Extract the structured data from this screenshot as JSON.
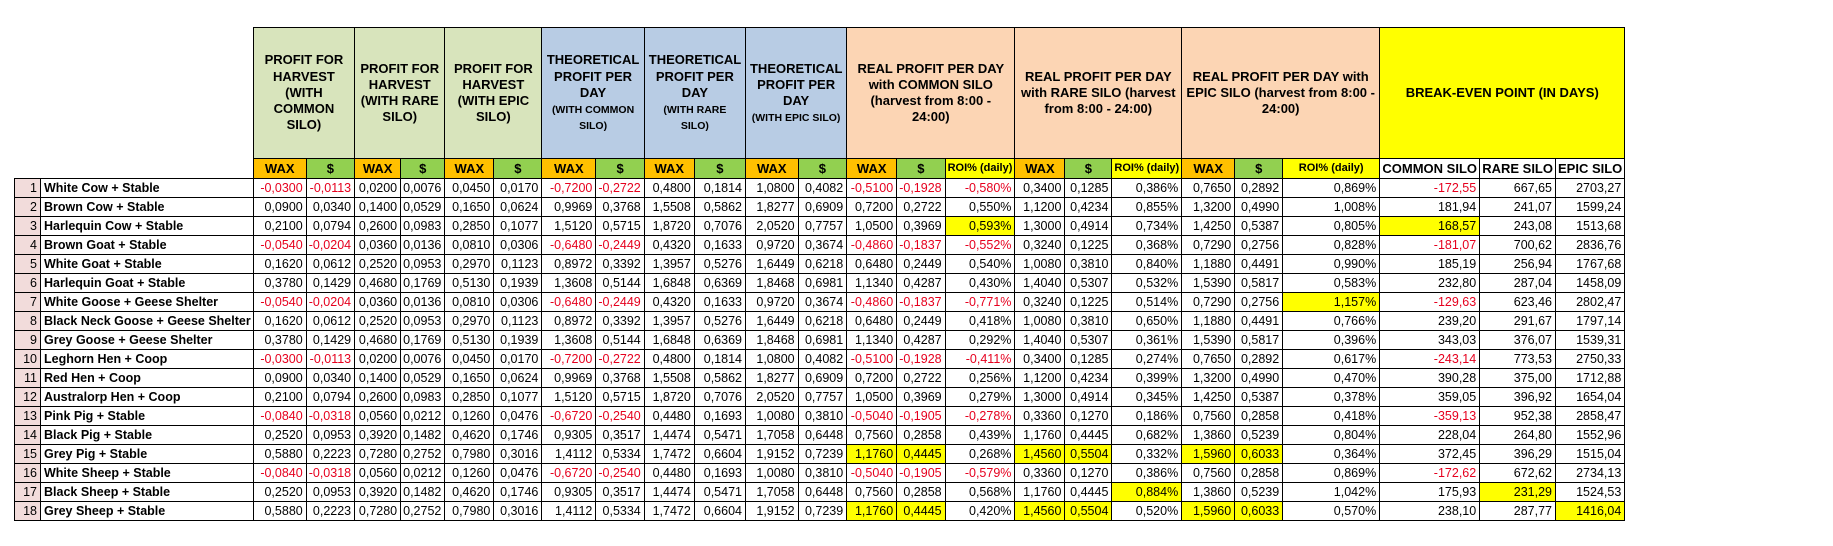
{
  "group_headers": [
    {
      "title": "PROFIT FOR HARVEST (WITH COMMON SILO)",
      "sub": ""
    },
    {
      "title": "PROFIT FOR HARVEST (WITH RARE SILO)",
      "sub": ""
    },
    {
      "title": "PROFIT FOR HARVEST (WITH EPIC SILO)",
      "sub": ""
    },
    {
      "title": "THEORETICAL PROFIT PER DAY",
      "sub": "(WITH COMMON SILO)"
    },
    {
      "title": "THEORETICAL PROFIT PER DAY",
      "sub": "(WITH RARE SILO)"
    },
    {
      "title": "THEORETICAL PROFIT PER DAY",
      "sub": "(WITH EPIC SILO)"
    },
    {
      "title": "REAL PROFIT PER DAY with COMMON SILO (harvest from 8:00 - 24:00)",
      "sub": ""
    },
    {
      "title": "REAL PROFIT PER DAY with RARE SILO (harvest from 8:00 - 24:00)",
      "sub": ""
    },
    {
      "title": "REAL PROFIT PER DAY with EPIC SILO (harvest from 8:00 - 24:00)",
      "sub": ""
    },
    {
      "title": "BREAK-EVEN POINT (IN DAYS)",
      "sub": ""
    }
  ],
  "sub_headers": {
    "wax": "WAX",
    "usd": "$",
    "roi": "ROI% (daily)",
    "common": "COMMON SILO",
    "rare": "RARE SILO",
    "epic": "EPIC SILO"
  },
  "rows": [
    {
      "n": "1",
      "name": "White Cow + Stable",
      "v": [
        "-0,0300",
        "-0,0113",
        "0,0200",
        "0,0076",
        "0,0450",
        "0,0170",
        "-0,7200",
        "-0,2722",
        "0,4800",
        "0,1814",
        "1,0800",
        "0,4082",
        "-0,5100",
        "-0,1928",
        "-0,580%",
        "0,3400",
        "0,1285",
        "0,386%",
        "0,7650",
        "0,2892",
        "0,869%",
        "-172,55",
        "667,65",
        "2703,27"
      ]
    },
    {
      "n": "2",
      "name": "Brown Cow  + Stable",
      "v": [
        "0,0900",
        "0,0340",
        "0,1400",
        "0,0529",
        "0,1650",
        "0,0624",
        "0,9969",
        "0,3768",
        "1,5508",
        "0,5862",
        "1,8277",
        "0,6909",
        "0,7200",
        "0,2722",
        "0,550%",
        "1,1200",
        "0,4234",
        "0,855%",
        "1,3200",
        "0,4990",
        "1,008%",
        "181,94",
        "241,07",
        "1599,24"
      ]
    },
    {
      "n": "3",
      "name": "Harlequin Cow + Stable",
      "v": [
        "0,2100",
        "0,0794",
        "0,2600",
        "0,0983",
        "0,2850",
        "0,1077",
        "1,5120",
        "0,5715",
        "1,8720",
        "0,7076",
        "2,0520",
        "0,7757",
        "1,0500",
        "0,3969",
        "0,593%",
        "1,3000",
        "0,4914",
        "0,734%",
        "1,4250",
        "0,5387",
        "0,805%",
        "168,57",
        "243,08",
        "1513,68"
      ]
    },
    {
      "n": "4",
      "name": "Brown Goat + Stable",
      "v": [
        "-0,0540",
        "-0,0204",
        "0,0360",
        "0,0136",
        "0,0810",
        "0,0306",
        "-0,6480",
        "-0,2449",
        "0,4320",
        "0,1633",
        "0,9720",
        "0,3674",
        "-0,4860",
        "-0,1837",
        "-0,552%",
        "0,3240",
        "0,1225",
        "0,368%",
        "0,7290",
        "0,2756",
        "0,828%",
        "-181,07",
        "700,62",
        "2836,76"
      ]
    },
    {
      "n": "5",
      "name": "White Goat + Stable",
      "v": [
        "0,1620",
        "0,0612",
        "0,2520",
        "0,0953",
        "0,2970",
        "0,1123",
        "0,8972",
        "0,3392",
        "1,3957",
        "0,5276",
        "1,6449",
        "0,6218",
        "0,6480",
        "0,2449",
        "0,540%",
        "1,0080",
        "0,3810",
        "0,840%",
        "1,1880",
        "0,4491",
        "0,990%",
        "185,19",
        "256,94",
        "1767,68"
      ]
    },
    {
      "n": "6",
      "name": "Harlequin Goat + Stable",
      "v": [
        "0,3780",
        "0,1429",
        "0,4680",
        "0,1769",
        "0,5130",
        "0,1939",
        "1,3608",
        "0,5144",
        "1,6848",
        "0,6369",
        "1,8468",
        "0,6981",
        "1,1340",
        "0,4287",
        "0,430%",
        "1,4040",
        "0,5307",
        "0,532%",
        "1,5390",
        "0,5817",
        "0,583%",
        "232,80",
        "287,04",
        "1458,09"
      ]
    },
    {
      "n": "7",
      "name": "White Goose + Geese Shelter",
      "v": [
        "-0,0540",
        "-0,0204",
        "0,0360",
        "0,0136",
        "0,0810",
        "0,0306",
        "-0,6480",
        "-0,2449",
        "0,4320",
        "0,1633",
        "0,9720",
        "0,3674",
        "-0,4860",
        "-0,1837",
        "-0,771%",
        "0,3240",
        "0,1225",
        "0,514%",
        "0,7290",
        "0,2756",
        "1,157%",
        "-129,63",
        "623,46",
        "2802,47"
      ]
    },
    {
      "n": "8",
      "name": "Black Neck Goose + Geese Shelter",
      "v": [
        "0,1620",
        "0,0612",
        "0,2520",
        "0,0953",
        "0,2970",
        "0,1123",
        "0,8972",
        "0,3392",
        "1,3957",
        "0,5276",
        "1,6449",
        "0,6218",
        "0,6480",
        "0,2449",
        "0,418%",
        "1,0080",
        "0,3810",
        "0,650%",
        "1,1880",
        "0,4491",
        "0,766%",
        "239,20",
        "291,67",
        "1797,14"
      ]
    },
    {
      "n": "9",
      "name": "Grey Goose + Geese Shelter",
      "v": [
        "0,3780",
        "0,1429",
        "0,4680",
        "0,1769",
        "0,5130",
        "0,1939",
        "1,3608",
        "0,5144",
        "1,6848",
        "0,6369",
        "1,8468",
        "0,6981",
        "1,1340",
        "0,4287",
        "0,292%",
        "1,4040",
        "0,5307",
        "0,361%",
        "1,5390",
        "0,5817",
        "0,396%",
        "343,03",
        "376,07",
        "1539,31"
      ]
    },
    {
      "n": "10",
      "name": "Leghorn Hen + Coop",
      "v": [
        "-0,0300",
        "-0,0113",
        "0,0200",
        "0,0076",
        "0,0450",
        "0,0170",
        "-0,7200",
        "-0,2722",
        "0,4800",
        "0,1814",
        "1,0800",
        "0,4082",
        "-0,5100",
        "-0,1928",
        "-0,411%",
        "0,3400",
        "0,1285",
        "0,274%",
        "0,7650",
        "0,2892",
        "0,617%",
        "-243,14",
        "773,53",
        "2750,33"
      ]
    },
    {
      "n": "11",
      "name": "Red Hen + Coop",
      "v": [
        "0,0900",
        "0,0340",
        "0,1400",
        "0,0529",
        "0,1650",
        "0,0624",
        "0,9969",
        "0,3768",
        "1,5508",
        "0,5862",
        "1,8277",
        "0,6909",
        "0,7200",
        "0,2722",
        "0,256%",
        "1,1200",
        "0,4234",
        "0,399%",
        "1,3200",
        "0,4990",
        "0,470%",
        "390,28",
        "375,00",
        "1712,88"
      ]
    },
    {
      "n": "12",
      "name": "Australorp Hen + Coop",
      "v": [
        "0,2100",
        "0,0794",
        "0,2600",
        "0,0983",
        "0,2850",
        "0,1077",
        "1,5120",
        "0,5715",
        "1,8720",
        "0,7076",
        "2,0520",
        "0,7757",
        "1,0500",
        "0,3969",
        "0,279%",
        "1,3000",
        "0,4914",
        "0,345%",
        "1,4250",
        "0,5387",
        "0,378%",
        "359,05",
        "396,92",
        "1654,04"
      ]
    },
    {
      "n": "13",
      "name": "Pink Pig + Stable",
      "v": [
        "-0,0840",
        "-0,0318",
        "0,0560",
        "0,0212",
        "0,1260",
        "0,0476",
        "-0,6720",
        "-0,2540",
        "0,4480",
        "0,1693",
        "1,0080",
        "0,3810",
        "-0,5040",
        "-0,1905",
        "-0,278%",
        "0,3360",
        "0,1270",
        "0,186%",
        "0,7560",
        "0,2858",
        "0,418%",
        "-359,13",
        "952,38",
        "2858,47"
      ]
    },
    {
      "n": "14",
      "name": "Black Pig + Stable",
      "v": [
        "0,2520",
        "0,0953",
        "0,3920",
        "0,1482",
        "0,4620",
        "0,1746",
        "0,9305",
        "0,3517",
        "1,4474",
        "0,5471",
        "1,7058",
        "0,6448",
        "0,7560",
        "0,2858",
        "0,439%",
        "1,1760",
        "0,4445",
        "0,682%",
        "1,3860",
        "0,5239",
        "0,804%",
        "228,04",
        "264,80",
        "1552,96"
      ]
    },
    {
      "n": "15",
      "name": "Grey Pig + Stable",
      "v": [
        "0,5880",
        "0,2223",
        "0,7280",
        "0,2752",
        "0,7980",
        "0,3016",
        "1,4112",
        "0,5334",
        "1,7472",
        "0,6604",
        "1,9152",
        "0,7239",
        "1,1760",
        "0,4445",
        "0,268%",
        "1,4560",
        "0,5504",
        "0,332%",
        "1,5960",
        "0,6033",
        "0,364%",
        "372,45",
        "396,29",
        "1515,04"
      ]
    },
    {
      "n": "16",
      "name": "White Sheep + Stable",
      "v": [
        "-0,0840",
        "-0,0318",
        "0,0560",
        "0,0212",
        "0,1260",
        "0,0476",
        "-0,6720",
        "-0,2540",
        "0,4480",
        "0,1693",
        "1,0080",
        "0,3810",
        "-0,5040",
        "-0,1905",
        "-0,579%",
        "0,3360",
        "0,1270",
        "0,386%",
        "0,7560",
        "0,2858",
        "0,869%",
        "-172,62",
        "672,62",
        "2734,13"
      ]
    },
    {
      "n": "17",
      "name": "Black Sheep + Stable",
      "v": [
        "0,2520",
        "0,0953",
        "0,3920",
        "0,1482",
        "0,4620",
        "0,1746",
        "0,9305",
        "0,3517",
        "1,4474",
        "0,5471",
        "1,7058",
        "0,6448",
        "0,7560",
        "0,2858",
        "0,568%",
        "1,1760",
        "0,4445",
        "0,884%",
        "1,3860",
        "0,5239",
        "1,042%",
        "175,93",
        "231,29",
        "1524,53"
      ]
    },
    {
      "n": "18",
      "name": "Grey Sheep + Stable",
      "v": [
        "0,5880",
        "0,2223",
        "0,7280",
        "0,2752",
        "0,7980",
        "0,3016",
        "1,4112",
        "0,5334",
        "1,7472",
        "0,6604",
        "1,9152",
        "0,7239",
        "1,1760",
        "0,4445",
        "0,420%",
        "1,4560",
        "0,5504",
        "0,520%",
        "1,5960",
        "0,6033",
        "0,570%",
        "238,10",
        "287,77",
        "1416,04"
      ]
    }
  ],
  "highlights": [
    [
      2,
      14
    ],
    [
      2,
      21
    ],
    [
      6,
      20
    ],
    [
      14,
      12
    ],
    [
      14,
      13
    ],
    [
      14,
      15
    ],
    [
      14,
      16
    ],
    [
      14,
      18
    ],
    [
      14,
      19
    ],
    [
      16,
      17
    ],
    [
      16,
      22
    ],
    [
      17,
      12
    ],
    [
      17,
      13
    ],
    [
      17,
      15
    ],
    [
      17,
      16
    ],
    [
      17,
      18
    ],
    [
      17,
      19
    ],
    [
      17,
      23
    ]
  ],
  "colors": {
    "group_green": "#d8e4bc",
    "group_blue": "#b8cce4",
    "group_peach": "#fcd5b4",
    "group_yellow": "#ffff00",
    "sub_orange": "#ffc000",
    "sub_green": "#92d050",
    "row_number_bg": "#f2dcdb",
    "negative_text": "#e6001e",
    "highlight": "#ffff00"
  }
}
